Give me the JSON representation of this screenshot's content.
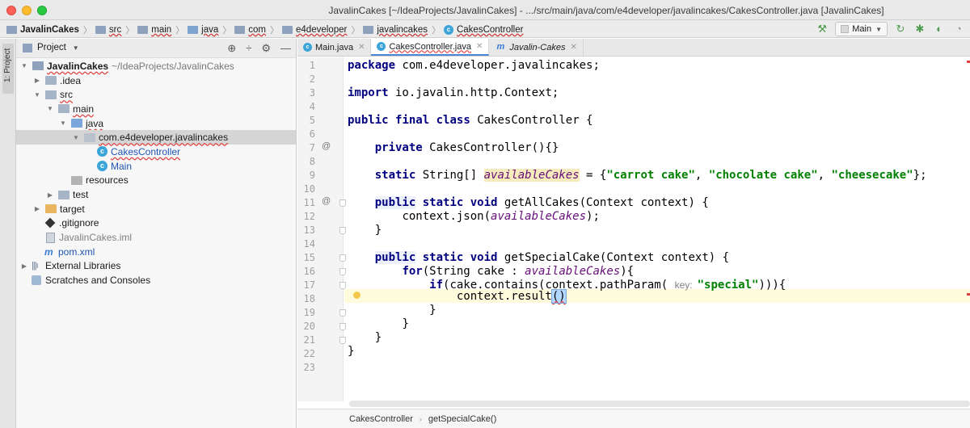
{
  "window": {
    "title": "JavalinCakes [~/IdeaProjects/JavalinCakes] - .../src/main/java/com/e4developer/javalincakes/CakesController.java [JavalinCakes]"
  },
  "navbar": {
    "crumbs": [
      "JavalinCakes",
      "src",
      "main",
      "java",
      "com",
      "e4developer",
      "javalincakes",
      "CakesController"
    ],
    "run_config": "Main"
  },
  "toolstrip": {
    "project_tab": "1: Project"
  },
  "project_panel": {
    "header": "Project",
    "tree": [
      {
        "label": "JavalinCakes",
        "suffix": "~/IdeaProjects/JavalinCakes"
      },
      {
        "label": ".idea"
      },
      {
        "label": "src"
      },
      {
        "label": "main"
      },
      {
        "label": "java"
      },
      {
        "label": "com.e4developer.javalincakes"
      },
      {
        "label": "CakesController"
      },
      {
        "label": "Main"
      },
      {
        "label": "resources"
      },
      {
        "label": "test"
      },
      {
        "label": "target"
      },
      {
        "label": ".gitignore"
      },
      {
        "label": "JavalinCakes.iml"
      },
      {
        "label": "pom.xml"
      },
      {
        "label": "External Libraries"
      },
      {
        "label": "Scratches and Consoles"
      }
    ]
  },
  "tabs": [
    {
      "label": "Main.java"
    },
    {
      "label": "CakesController.java"
    },
    {
      "label": "Javalin-Cakes"
    }
  ],
  "editor": {
    "line_numbers": [
      "1",
      "2",
      "3",
      "4",
      "5",
      "6",
      "7",
      "8",
      "9",
      "10",
      "11",
      "12",
      "13",
      "14",
      "15",
      "16",
      "17",
      "18",
      "19",
      "20",
      "21",
      "22",
      "23"
    ],
    "gutter_at": "@",
    "code": {
      "l1_kw": "package",
      "l1_rest": " com.e4developer.javalincakes;",
      "l3_kw": "import",
      "l3_rest": " io.javalin.http.Context;",
      "l5_kw1": "public",
      "l5_kw2": "final",
      "l5_kw3": "class",
      "l5_rest": " CakesController {",
      "l7_kw": "private",
      "l7_rest": " CakesController(){}",
      "l9_kw": "static",
      "l9_type": " String[] ",
      "l9_field": "availableCakes",
      "l9_eq": " = {",
      "l9_s1": "\"carrot cake\"",
      "l9_c1": ", ",
      "l9_s2": "\"chocolate cake\"",
      "l9_c2": ", ",
      "l9_s3": "\"cheesecake\"",
      "l9_end": "};",
      "l11_kw1": "public",
      "l11_kw2": "static",
      "l11_kw3": "void",
      "l11_rest": " getAllCakes(Context context) {",
      "l12_pre": "context.json(",
      "l12_field": "availableCakes",
      "l12_post": ");",
      "l13": "}",
      "l15_kw1": "public",
      "l15_kw2": "static",
      "l15_kw3": "void",
      "l15_rest": " getSpecialCake(Context context) {",
      "l16_kw": "for",
      "l16_mid": "(String cake : ",
      "l16_field": "availableCakes",
      "l16_end": "){",
      "l17_kw": "if",
      "l17_mid": "(cake.contains(context.pathParam( ",
      "l17_hint": "key:",
      "l17_str": "\"special\"",
      "l17_end": "))){",
      "l18_pre": "context.result",
      "l18_paren": "()",
      "l19": "}",
      "l20": "}",
      "l21": "}",
      "l22": "}"
    }
  },
  "bottom_breadcrumb": [
    "CakesController",
    "getSpecialCake()"
  ]
}
